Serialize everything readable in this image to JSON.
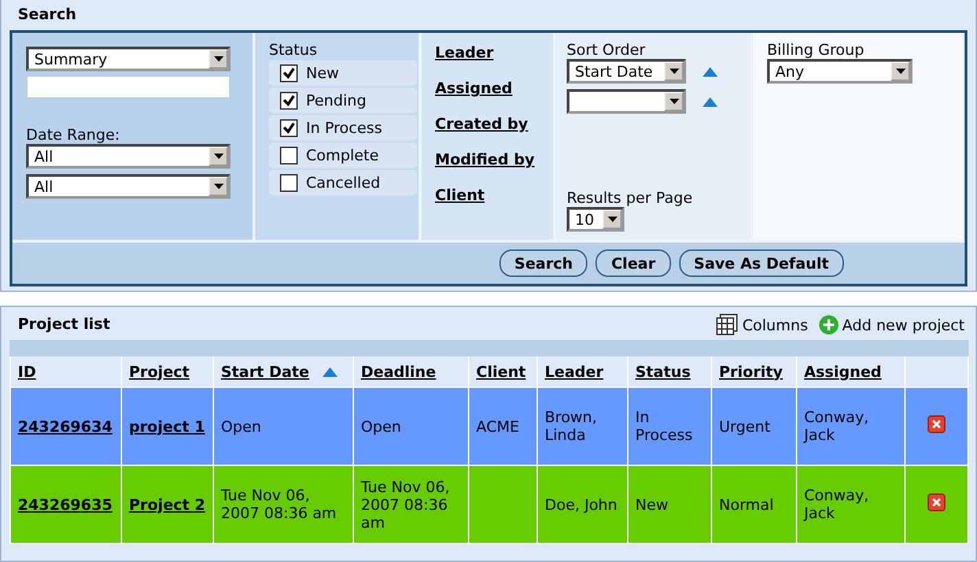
{
  "search": {
    "title": "Search",
    "view_select": {
      "value": "Summary"
    },
    "date_range": {
      "label": "Date Range:",
      "from": "All",
      "to": "All"
    },
    "status": {
      "label": "Status",
      "options": [
        {
          "label": "New",
          "checked": true
        },
        {
          "label": "Pending",
          "checked": true
        },
        {
          "label": "In Process",
          "checked": true
        },
        {
          "label": "Complete",
          "checked": false
        },
        {
          "label": "Cancelled",
          "checked": false
        }
      ]
    },
    "links": [
      "Leader",
      "Assigned",
      "Created by",
      "Modified by",
      "Client"
    ],
    "sort_order": {
      "label": "Sort Order",
      "first": "Start Date"
    },
    "results_per_page": {
      "label": "Results per Page",
      "value": "10"
    },
    "billing_group": {
      "label": "Billing Group",
      "value": "Any"
    },
    "buttons": [
      "Search",
      "Clear",
      "Save As Default"
    ]
  },
  "project_list": {
    "title": "Project list",
    "actions": [
      {
        "kind": "columns",
        "label": "Columns"
      },
      {
        "kind": "add",
        "label": "Add new project"
      }
    ],
    "columns": [
      {
        "label": "ID",
        "sorted": false
      },
      {
        "label": "Project",
        "sorted": false
      },
      {
        "label": "Start Date",
        "sorted": true
      },
      {
        "label": "Deadline",
        "sorted": false
      },
      {
        "label": "Client",
        "sorted": false
      },
      {
        "label": "Leader",
        "sorted": false
      },
      {
        "label": "Status",
        "sorted": false
      },
      {
        "label": "Priority",
        "sorted": false
      },
      {
        "label": "Assigned",
        "sorted": false
      }
    ],
    "rows": [
      {
        "color": "#6699ff",
        "id": "243269634",
        "project": "project 1",
        "start_date": "Open",
        "deadline": "Open",
        "client": "ACME",
        "leader": "Brown, Linda",
        "status": "In Process",
        "priority": "Urgent",
        "assigned": "Conway, Jack"
      },
      {
        "color": "#66cc00",
        "id": "243269635",
        "project": "Project 2",
        "start_date": "Tue Nov 06, 2007 08:36 am",
        "deadline": "Tue Nov 06, 2007 08:36 am",
        "client": "",
        "leader": "Doe, John",
        "status": "New",
        "priority": "Normal",
        "assigned": "Conway, Jack"
      }
    ]
  }
}
